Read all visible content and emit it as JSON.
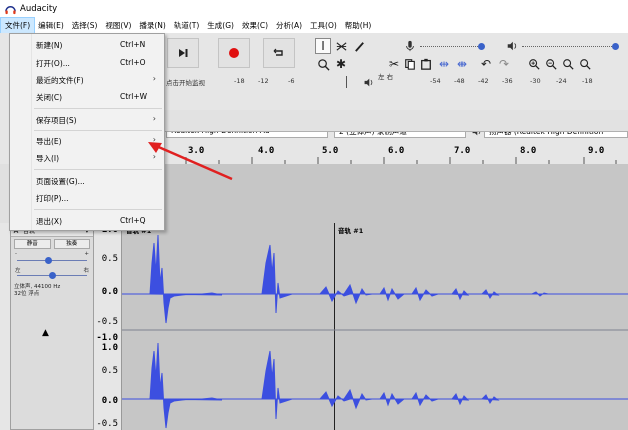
{
  "window": {
    "title": "Audacity"
  },
  "menubar": [
    "文件(F)",
    "编辑(E)",
    "选择(S)",
    "视图(V)",
    "播录(N)",
    "轨道(T)",
    "生成(G)",
    "效果(C)",
    "分析(A)",
    "工具(O)",
    "帮助(H)"
  ],
  "file_menu": {
    "items": [
      {
        "label": "新建(N)",
        "shortcut": "Ctrl+N",
        "submenu": false
      },
      {
        "label": "打开(O)...",
        "shortcut": "Ctrl+O",
        "submenu": false
      },
      {
        "label": "最近的文件(F)",
        "shortcut": "",
        "submenu": true
      },
      {
        "label": "关闭(C)",
        "shortcut": "Ctrl+W",
        "submenu": false
      },
      {
        "label": "保存项目(S)",
        "shortcut": "",
        "submenu": true
      },
      {
        "label": "导出(E)",
        "shortcut": "",
        "submenu": true
      },
      {
        "label": "导入(I)",
        "shortcut": "",
        "submenu": true
      },
      {
        "label": "页面设置(G)...",
        "shortcut": "",
        "submenu": false
      },
      {
        "label": "打印(P)...",
        "shortcut": "",
        "submenu": false
      },
      {
        "label": "退出(X)",
        "shortcut": "Ctrl+Q",
        "submenu": false
      }
    ]
  },
  "toolbar": {
    "meter_hint": "点击开始监视",
    "meter_scale_rec": [
      "-18",
      "-12",
      "-6"
    ],
    "meter_scale_play": [
      "-54",
      "-48",
      "-42",
      "-36",
      "-30",
      "-24",
      "-18"
    ],
    "meter_lr": "左\n右"
  },
  "devices": {
    "output_device": "Realtek High Definition Au",
    "channels": "2 (立体声) 录制声道",
    "playback_label": "扬声器 (Realtek High Definition"
  },
  "ruler": {
    "labels": [
      "3.0",
      "4.0",
      "5.0",
      "6.0",
      "7.0",
      "8.0",
      "9.0"
    ]
  },
  "track": {
    "name": "音轨",
    "mute_label": "静音",
    "solo_label": "独奏",
    "gain_minus": "-",
    "gain_plus": "+",
    "pan_left": "左",
    "pan_right": "右",
    "info_line1": "立体声, 44100 Hz",
    "info_line2": "32位 浮点",
    "clip_labels": [
      "音轨 #1",
      "音轨 #1"
    ],
    "amp_labels": [
      "1.0",
      "0.5",
      "0.0",
      "-0.5",
      "-1.0",
      "1.0",
      "0.5",
      "0.0",
      "-0.5"
    ]
  },
  "colors": {
    "waveform": "#3c4fe0",
    "record": "#e01010",
    "menu_highlight": "#cce8ff",
    "annotation_arrow": "#e02020"
  }
}
